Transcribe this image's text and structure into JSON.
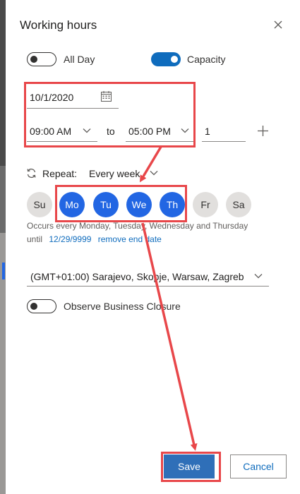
{
  "dialog": {
    "title": "Working hours"
  },
  "all_day": {
    "label": "All Day",
    "on": false
  },
  "capacity": {
    "label": "Capacity",
    "on": true,
    "value": "1"
  },
  "date": {
    "value": "10/1/2020"
  },
  "time": {
    "start": "09:00 AM",
    "separator": "to",
    "end": "05:00 PM"
  },
  "repeat": {
    "label": "Repeat:",
    "value": "Every week"
  },
  "days": [
    {
      "label": "Su",
      "selected": false
    },
    {
      "label": "Mo",
      "selected": true
    },
    {
      "label": "Tu",
      "selected": true
    },
    {
      "label": "We",
      "selected": true
    },
    {
      "label": "Th",
      "selected": true
    },
    {
      "label": "Fr",
      "selected": false
    },
    {
      "label": "Sa",
      "selected": false
    }
  ],
  "occurs": {
    "text": "Occurs every Monday, Tuesday, Wednesday and Thursday",
    "until_label": "until",
    "until_date": "12/29/9999",
    "remove_label": "remove end date"
  },
  "timezone": {
    "value": "(GMT+01:00) Sarajevo, Skopje, Warsaw, Zagreb"
  },
  "business_closure": {
    "label": "Observe Business Closure",
    "on": false
  },
  "footer": {
    "save_label": "Save",
    "cancel_label": "Cancel"
  },
  "colors": {
    "accent": "#2266e3",
    "highlight": "#e8474a",
    "save": "#2f6fb8"
  }
}
